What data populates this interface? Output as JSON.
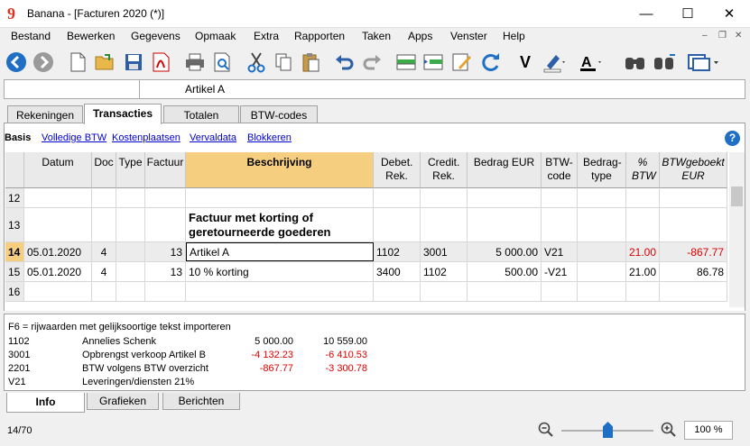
{
  "window": {
    "title": "Banana - [Facturen 2020 (*)]",
    "app_icon": "banana-logo-icon"
  },
  "menu": [
    "Bestand",
    "Bewerken",
    "Gegevens",
    "Opmaak",
    "Extra",
    "Rapporten",
    "Taken",
    "Apps",
    "Venster",
    "Help"
  ],
  "cell_editor": {
    "cell_ref": "",
    "content": "Artikel A"
  },
  "tabs": [
    "Rekeningen",
    "Transacties",
    "Totalen",
    "BTW-codes"
  ],
  "active_tab": "Transacties",
  "views": [
    "Basis",
    "Volledige BTW",
    "Kostenplaatsen",
    "Vervaldata",
    "Blokkeren"
  ],
  "active_view": "Basis",
  "columns": {
    "datum": "Datum",
    "doc": "Doc",
    "type": "Type",
    "factuur": "Factuur",
    "beschrijving": "Beschrijving",
    "debet": "Debet. Rek.",
    "credit": "Credit. Rek.",
    "bedrag": "Bedrag EUR",
    "btwcode": "BTW-code",
    "bedragtype": "Bedrag-type",
    "pct": "% BTW",
    "btwgeboekt": "BTWgeboekt EUR"
  },
  "rows": [
    {
      "n": "12",
      "datum": "",
      "doc": "",
      "type": "",
      "factuur": "",
      "beschrijving": "",
      "debet": "",
      "credit": "",
      "bedrag": "",
      "btwcode": "",
      "bedragtype": "",
      "pct": "",
      "btwgeboekt": ""
    },
    {
      "n": "13",
      "datum": "",
      "doc": "",
      "type": "",
      "factuur": "",
      "beschrijving": "Factuur met korting of geretourneerde goederen",
      "debet": "",
      "credit": "",
      "bedrag": "",
      "btwcode": "",
      "bedragtype": "",
      "pct": "",
      "btwgeboekt": ""
    },
    {
      "n": "14",
      "datum": "05.01.2020",
      "doc": "4",
      "type": "",
      "factuur": "13",
      "beschrijving": "Artikel A",
      "debet": "1102",
      "credit": "3001",
      "bedrag": "5 000.00",
      "btwcode": "V21",
      "bedragtype": "",
      "pct": "21.00",
      "btwgeboekt": "-867.77"
    },
    {
      "n": "15",
      "datum": "05.01.2020",
      "doc": "4",
      "type": "",
      "factuur": "13",
      "beschrijving": "10 % korting",
      "debet": "3400",
      "credit": "1102",
      "bedrag": "500.00",
      "btwcode": "-V21",
      "bedragtype": "",
      "pct": "21.00",
      "btwgeboekt": "86.78"
    },
    {
      "n": "16",
      "datum": "",
      "doc": "",
      "type": "",
      "factuur": "",
      "beschrijving": "",
      "debet": "",
      "credit": "",
      "bedrag": "",
      "btwcode": "",
      "bedragtype": "",
      "pct": "",
      "btwgeboekt": ""
    }
  ],
  "info": {
    "hint": "F6 = rijwaarden met gelijksoortige tekst importeren",
    "lines": [
      {
        "code": "1102",
        "name": "Annelies Schenk",
        "a": "5 000.00",
        "b": "10 559.00",
        "red": false
      },
      {
        "code": "3001",
        "name": "Opbrengst verkoop Artikel B",
        "a": "-4 132.23",
        "b": "-6 410.53",
        "red": true
      },
      {
        "code": "2201",
        "name": "BTW volgens BTW overzicht",
        "a": "-867.77",
        "b": "-3 300.78",
        "red": true
      },
      {
        "code": "V21",
        "name": "Leveringen/diensten 21%",
        "a": "",
        "b": "",
        "red": false
      }
    ]
  },
  "bottom_tabs": [
    "Info",
    "Grafieken",
    "Berichten"
  ],
  "status": {
    "position": "14/70",
    "zoom": "100 %",
    "zoom_level": 0.5
  },
  "colors": {
    "selected_header": "#f5ce80",
    "negative": "#e00000",
    "link": "#0000d0",
    "nav": "#1f6fc5"
  }
}
